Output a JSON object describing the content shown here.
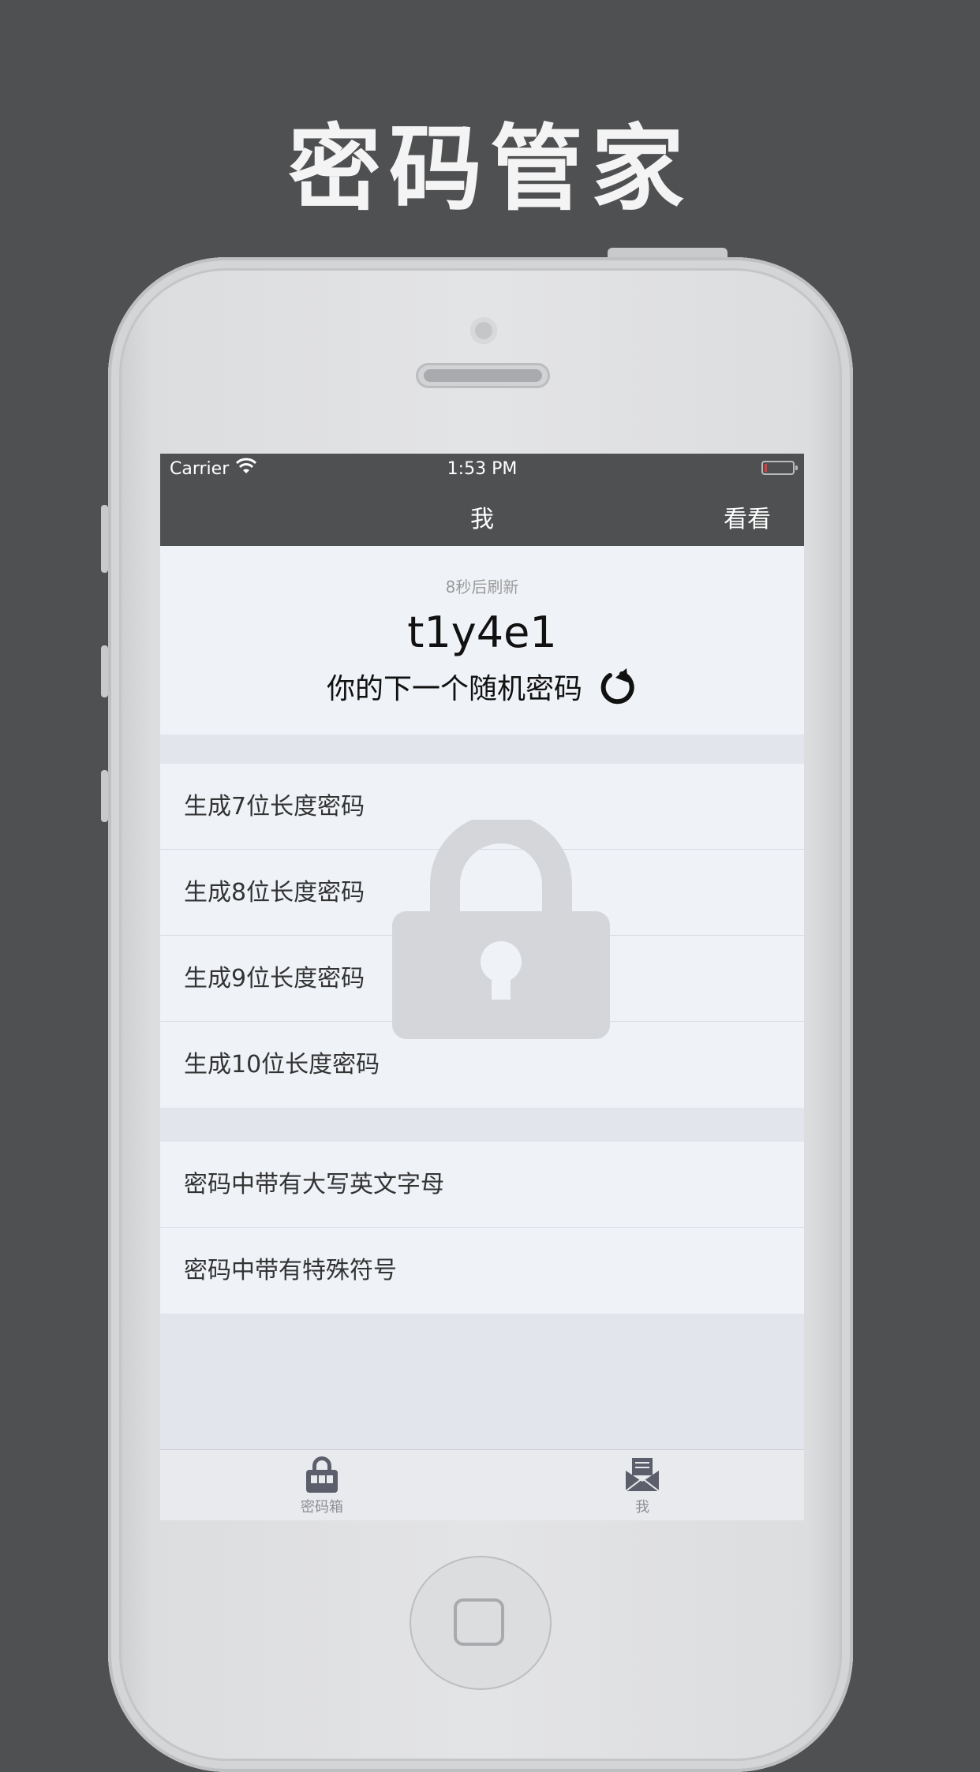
{
  "promo": {
    "title": "密码管家"
  },
  "status_bar": {
    "carrier": "Carrier",
    "time": "1:53 PM"
  },
  "nav": {
    "title": "我",
    "right_button": "看看"
  },
  "header": {
    "refresh_note": "8秒后刷新",
    "password": "t1y4e1",
    "subtitle": "你的下一个随机密码"
  },
  "length_options": [
    {
      "label": "生成7位长度密码"
    },
    {
      "label": "生成8位长度密码"
    },
    {
      "label": "生成9位长度密码"
    },
    {
      "label": "生成10位长度密码"
    }
  ],
  "char_options": [
    {
      "label": "密码中带有大写英文字母"
    },
    {
      "label": "密码中带有特殊符号"
    }
  ],
  "tab_bar": {
    "items": [
      {
        "label": "密码箱",
        "icon": "padlock-icon"
      },
      {
        "label": "我",
        "icon": "envelope-icon"
      }
    ]
  },
  "colors": {
    "dark_bar": "#4f5052",
    "content_bg": "#eff2f7",
    "section_bg": "#e2e5ec",
    "watermark": "#d4d6da"
  }
}
